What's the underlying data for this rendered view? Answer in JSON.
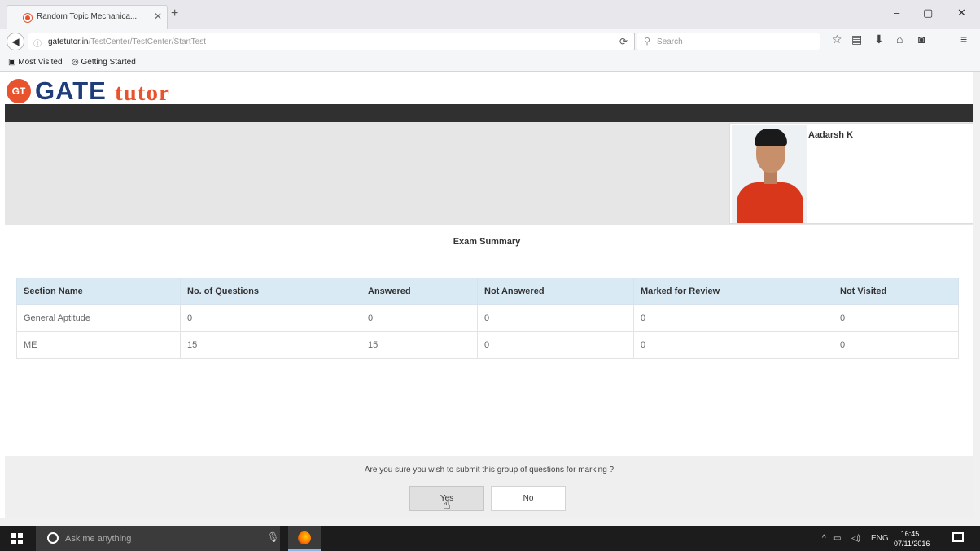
{
  "browser": {
    "tab_title": "Random Topic Mechanica...",
    "tab_close": "✕",
    "new_tab": "+",
    "url_domain": "gatetutor.in",
    "url_path": "/TestCenter/TestCenter/StartTest",
    "search_placeholder": "Search",
    "bookmarks": [
      "Most Visited",
      "Getting Started"
    ],
    "window_controls": [
      "–",
      "▢",
      "✕"
    ]
  },
  "site": {
    "logo_badge": "GT",
    "logo_gate": "GATE",
    "logo_tutor": "tutor"
  },
  "user": {
    "name": "Aadarsh K"
  },
  "summary": {
    "title": "Exam Summary",
    "columns": [
      "Section Name",
      "No. of Questions",
      "Answered",
      "Not Answered",
      "Marked for Review",
      "Not Visited"
    ],
    "rows": [
      [
        "General Aptitude",
        "0",
        "0",
        "0",
        "0",
        "0"
      ],
      [
        "ME",
        "15",
        "15",
        "0",
        "0",
        "0"
      ]
    ]
  },
  "confirm": {
    "message": "Are you sure you wish to submit this group of questions for marking ?",
    "yes_label": "Yes",
    "no_label": "No"
  },
  "taskbar": {
    "search_placeholder": "Ask me anything",
    "language": "ENG",
    "time": "16:45",
    "date": "07/11/2016"
  },
  "icons": [
    "back-arrow-icon",
    "info-icon",
    "reload-icon",
    "search-icon",
    "star-icon",
    "clipboard-icon",
    "download-icon",
    "home-icon",
    "pocket-icon",
    "menu-icon",
    "windows-icon",
    "cortana-icon",
    "mic-icon",
    "firefox-icon",
    "notification-icon"
  ]
}
